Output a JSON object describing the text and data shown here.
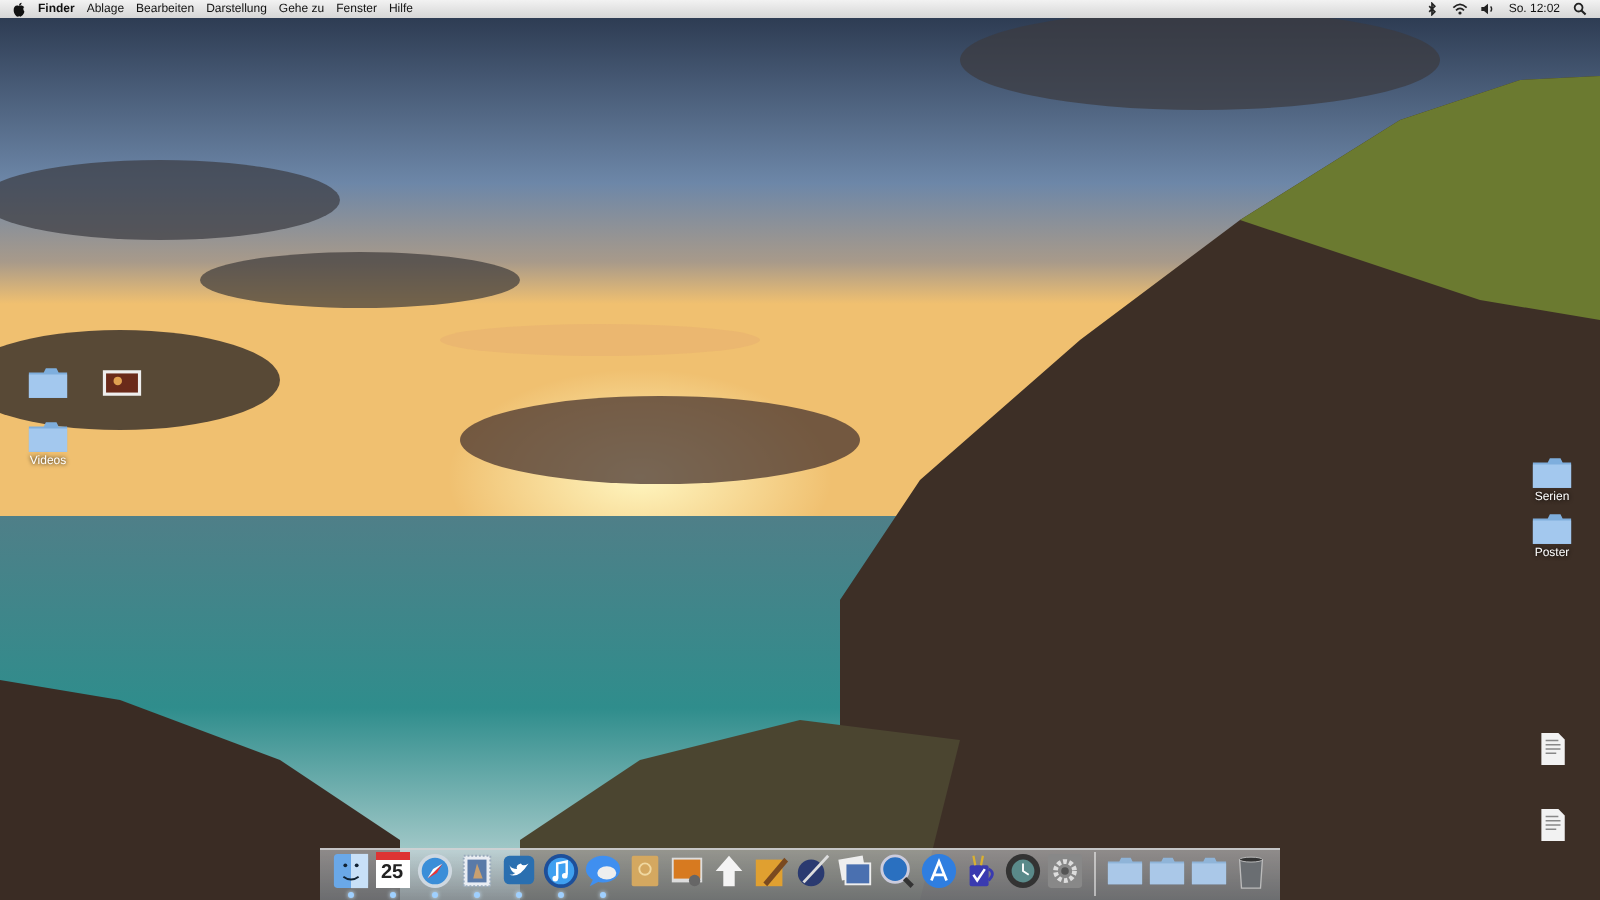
{
  "menu_bar": {
    "app_name": "Finder",
    "menus": [
      "Ablage",
      "Bearbeiten",
      "Darstellung",
      "Gehe zu",
      "Fenster",
      "Hilfe"
    ],
    "clock": "So. 12:02"
  },
  "desktop_icons_left": [
    {
      "kind": "folder"
    },
    {
      "kind": "image"
    },
    {
      "kind": "folder",
      "label": "Videos"
    }
  ],
  "desktop_icons_right": [
    {
      "kind": "folder",
      "label": "Serien"
    },
    {
      "kind": "folder",
      "label": "Poster"
    },
    {
      "kind": "document"
    },
    {
      "kind": "document"
    }
  ],
  "dock": {
    "calendar_day": "25",
    "items": [
      {
        "kind": "finder",
        "running": true
      },
      {
        "kind": "calendar",
        "running": true
      },
      {
        "kind": "compass",
        "running": true
      },
      {
        "kind": "stamp",
        "running": true
      },
      {
        "kind": "bird",
        "running": true
      },
      {
        "kind": "music",
        "running": true
      },
      {
        "kind": "chat",
        "running": true
      },
      {
        "kind": "box",
        "running": false
      },
      {
        "kind": "photo",
        "running": false
      },
      {
        "kind": "upload",
        "running": false
      },
      {
        "kind": "pencil",
        "running": false
      },
      {
        "kind": "pen",
        "running": false
      },
      {
        "kind": "photos",
        "running": false
      },
      {
        "kind": "magnifier",
        "running": false
      },
      {
        "kind": "appstore",
        "running": false
      },
      {
        "kind": "mug",
        "running": false
      },
      {
        "kind": "clock",
        "running": false
      },
      {
        "kind": "gear",
        "running": false
      },
      {
        "kind": "separator"
      },
      {
        "kind": "folder",
        "running": false
      },
      {
        "kind": "folder",
        "running": false
      },
      {
        "kind": "folder",
        "running": false
      },
      {
        "kind": "trash",
        "running": false
      }
    ]
  }
}
